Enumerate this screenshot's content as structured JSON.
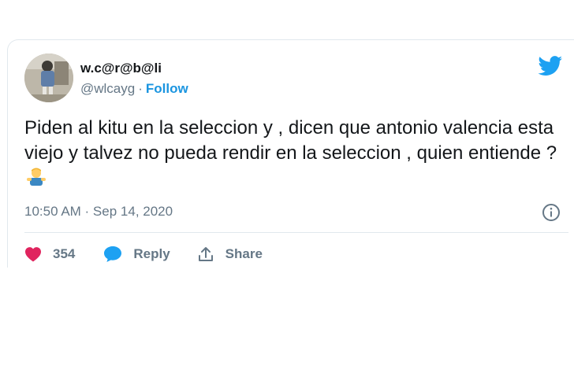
{
  "author": {
    "display_name": "w.c@r@b@li",
    "handle": "@wlcayg",
    "separator": "·",
    "follow_label": "Follow"
  },
  "tweet": {
    "text": "Piden al kitu en la seleccion y , dicen que antonio valencia esta viejo y talvez no pueda rendir en la seleccion , quien entiende ?",
    "emoji": "man-shrugging-emoji",
    "timestamp": "10:50 AM · Sep 14, 2020"
  },
  "actions": {
    "like_count": "354",
    "reply_label": "Reply",
    "share_label": "Share"
  },
  "icons": {
    "brand": "twitter-bird-icon",
    "info": "info-icon",
    "like": "heart-icon",
    "reply": "speech-bubble-icon",
    "share": "share-arrow-icon"
  },
  "colors": {
    "brand_blue": "#1da1f2",
    "follow_blue": "#1b95e0",
    "like_pink": "#e0245e",
    "text": "#14171a",
    "secondary": "#657786",
    "border": "#e1e8ed"
  }
}
